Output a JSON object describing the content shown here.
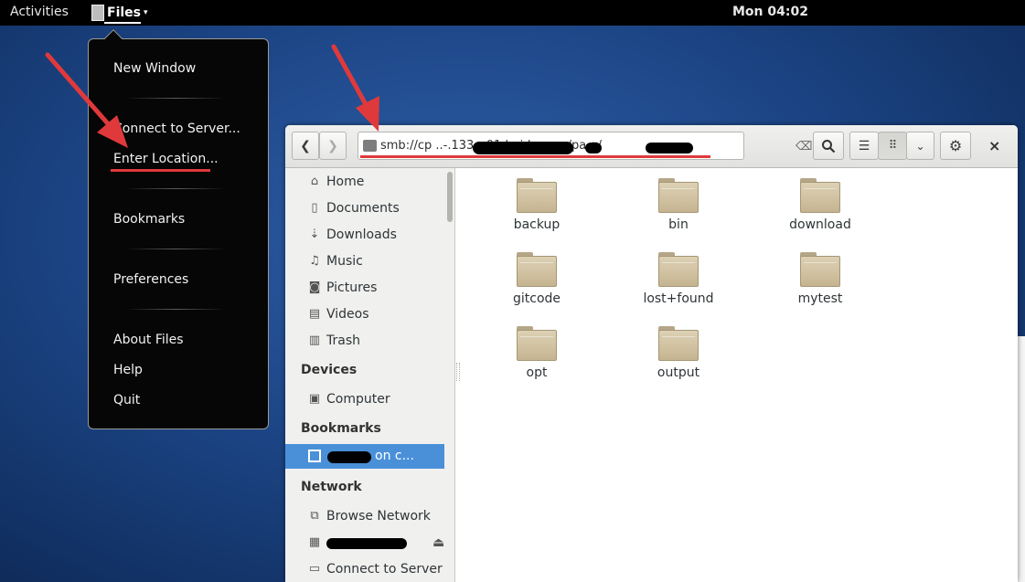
{
  "topbar": {
    "activities": "Activities",
    "app_name": "Files",
    "clock": "Mon 04:02"
  },
  "app_menu": {
    "items": [
      {
        "label": "New Window"
      },
      {
        "label": "Connect to Server..."
      },
      {
        "label": "Enter Location..."
      },
      {
        "label": "Bookmarks"
      },
      {
        "label": "Preferences"
      },
      {
        "label": "About Files"
      },
      {
        "label": "Help"
      },
      {
        "label": "Quit"
      }
    ]
  },
  "files_window": {
    "location": "smb://cp       ..-.133- -01.baidu.com/pa      g/",
    "sidebar": {
      "places": [
        {
          "label": "Home",
          "icon": "home-icon"
        },
        {
          "label": "Documents",
          "icon": "document-icon"
        },
        {
          "label": "Downloads",
          "icon": "download-icon"
        },
        {
          "label": "Music",
          "icon": "music-icon"
        },
        {
          "label": "Pictures",
          "icon": "camera-icon"
        },
        {
          "label": "Videos",
          "icon": "film-icon"
        },
        {
          "label": "Trash",
          "icon": "trash-icon"
        }
      ],
      "devices_heading": "Devices",
      "devices": [
        {
          "label": "Computer",
          "icon": "drive-icon"
        }
      ],
      "bookmarks_heading": "Bookmarks",
      "bookmark_selected": "on c...",
      "network_heading": "Network",
      "network": [
        {
          "label": "Browse Network",
          "icon": "network-icon"
        },
        {
          "label": "Connect to Server",
          "icon": "server-icon"
        }
      ]
    },
    "folders": [
      "backup",
      "bin",
      "download",
      "gitcode",
      "lost+found",
      "mytest",
      "opt",
      "output"
    ]
  },
  "colors": {
    "selection": "#4a90d9",
    "annotation_red": "#e0393b",
    "desktop_blue": "#1d4687"
  }
}
